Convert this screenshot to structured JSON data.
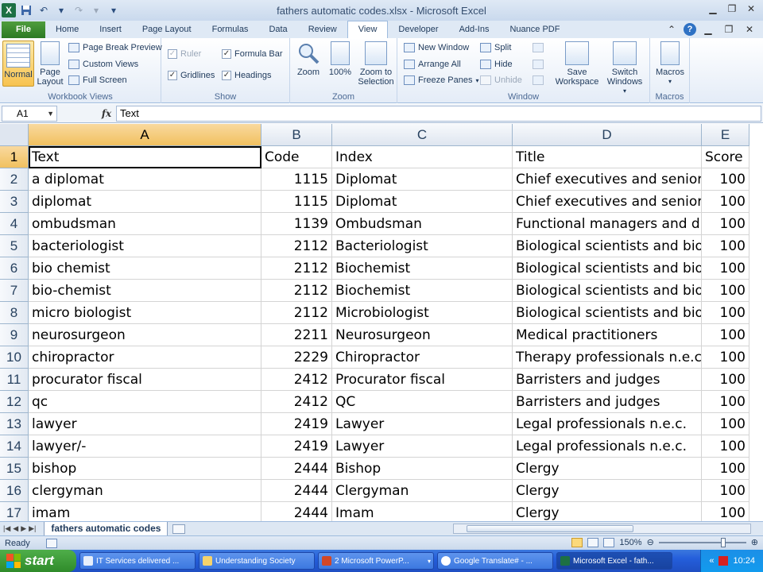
{
  "window": {
    "title": "fathers automatic codes.xlsx  -  Microsoft Excel"
  },
  "ribbon_tabs": [
    {
      "label": "File"
    },
    {
      "label": "Home"
    },
    {
      "label": "Insert"
    },
    {
      "label": "Page Layout"
    },
    {
      "label": "Formulas"
    },
    {
      "label": "Data"
    },
    {
      "label": "Review"
    },
    {
      "label": "View"
    },
    {
      "label": "Developer"
    },
    {
      "label": "Add-Ins"
    },
    {
      "label": "Nuance PDF"
    }
  ],
  "active_tab": "View",
  "ribbon": {
    "workbook_views": {
      "label": "Workbook Views",
      "normal": "Normal",
      "page_layout": "Page Layout",
      "page_break_preview": "Page Break Preview",
      "custom_views": "Custom Views",
      "full_screen": "Full Screen"
    },
    "show": {
      "label": "Show",
      "ruler": "Ruler",
      "formula_bar": "Formula Bar",
      "gridlines": "Gridlines",
      "headings": "Headings"
    },
    "zoom": {
      "label": "Zoom",
      "zoom": "Zoom",
      "zoom100": "100%",
      "zoom_to_selection": "Zoom to Selection"
    },
    "window": {
      "label": "Window",
      "new_window": "New Window",
      "arrange_all": "Arrange All",
      "freeze_panes": "Freeze Panes",
      "split": "Split",
      "hide": "Hide",
      "unhide": "Unhide",
      "save_workspace": "Save Workspace",
      "switch_windows": "Switch Windows"
    },
    "macros": {
      "label": "Macros",
      "macros": "Macros"
    }
  },
  "formula_bar": {
    "name_box": "A1",
    "fx": "fx",
    "content": "Text"
  },
  "columns": [
    "A",
    "B",
    "C",
    "D",
    "E"
  ],
  "rows": [
    {
      "n": "1",
      "cells": [
        "Text",
        "Code",
        "Index",
        "Title",
        "Score"
      ]
    },
    {
      "n": "2",
      "cells": [
        "a diplomat",
        "1115",
        "Diplomat",
        "Chief executives and senior",
        "100"
      ]
    },
    {
      "n": "3",
      "cells": [
        "diplomat",
        "1115",
        "Diplomat",
        "Chief executives and senior",
        "100"
      ]
    },
    {
      "n": "4",
      "cells": [
        "ombudsman",
        "1139",
        "Ombudsman",
        "Functional managers and di",
        "100"
      ]
    },
    {
      "n": "5",
      "cells": [
        "bacteriologist",
        "2112",
        "Bacteriologist",
        "Biological scientists and bio",
        "100"
      ]
    },
    {
      "n": "6",
      "cells": [
        "bio chemist",
        "2112",
        "Biochemist",
        "Biological scientists and bio",
        "100"
      ]
    },
    {
      "n": "7",
      "cells": [
        "bio-chemist",
        "2112",
        "Biochemist",
        "Biological scientists and bio",
        "100"
      ]
    },
    {
      "n": "8",
      "cells": [
        "micro biologist",
        "2112",
        "Microbiologist",
        "Biological scientists and bio",
        "100"
      ]
    },
    {
      "n": "9",
      "cells": [
        "neurosurgeon",
        "2211",
        "Neurosurgeon",
        "Medical practitioners",
        "100"
      ]
    },
    {
      "n": "10",
      "cells": [
        "chiropractor",
        "2229",
        "Chiropractor",
        "Therapy professionals n.e.c",
        "100"
      ]
    },
    {
      "n": "11",
      "cells": [
        "procurator fiscal",
        "2412",
        "Procurator fiscal",
        "Barristers and judges",
        "100"
      ]
    },
    {
      "n": "12",
      "cells": [
        "qc",
        "2412",
        "QC",
        "Barristers and judges",
        "100"
      ]
    },
    {
      "n": "13",
      "cells": [
        "lawyer",
        "2419",
        "Lawyer",
        "Legal professionals n.e.c.",
        "100"
      ]
    },
    {
      "n": "14",
      "cells": [
        "lawyer/-",
        "2419",
        "Lawyer",
        "Legal professionals n.e.c.",
        "100"
      ]
    },
    {
      "n": "15",
      "cells": [
        "bishop",
        "2444",
        "Bishop",
        "Clergy",
        "100"
      ]
    },
    {
      "n": "16",
      "cells": [
        "clergyman",
        "2444",
        "Clergyman",
        "Clergy",
        "100"
      ]
    },
    {
      "n": "17",
      "cells": [
        "imam",
        "2444",
        "Imam",
        "Clergy",
        "100"
      ]
    }
  ],
  "sheet_tab": "fathers automatic codes",
  "status": {
    "ready": "Ready",
    "zoom": "150%"
  },
  "taskbar": {
    "start": "start",
    "tasks": [
      {
        "label": "IT Services delivered ..."
      },
      {
        "label": "Understanding Society"
      },
      {
        "label": "2 Microsoft PowerP..."
      },
      {
        "label": "Google Translate# - ..."
      },
      {
        "label": "Microsoft Excel - fath..."
      }
    ],
    "clock": "10:24"
  }
}
